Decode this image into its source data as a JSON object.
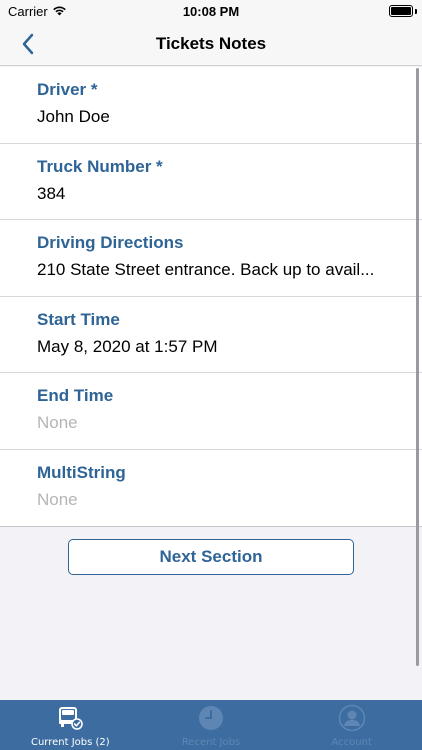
{
  "status_bar": {
    "carrier": "Carrier",
    "time": "10:08 PM"
  },
  "nav": {
    "title": "Tickets Notes"
  },
  "fields": [
    {
      "label": "Driver *",
      "value": "John Doe",
      "empty": false
    },
    {
      "label": "Truck Number *",
      "value": "384",
      "empty": false
    },
    {
      "label": "Driving Directions",
      "value": "210 State Street entrance. Back up to avail...",
      "empty": false
    },
    {
      "label": "Start Time",
      "value": "May 8, 2020 at 1:57 PM",
      "empty": false
    },
    {
      "label": "End Time",
      "value": "None",
      "empty": true
    },
    {
      "label": "MultiString",
      "value": "None",
      "empty": true
    }
  ],
  "next_button": {
    "label": "Next Section"
  },
  "tabs": [
    {
      "label": "Current Jobs (2)",
      "icon": "truck-icon",
      "active": true
    },
    {
      "label": "Recent Jobs",
      "icon": "clock-icon",
      "active": false
    },
    {
      "label": "Account",
      "icon": "person-icon",
      "active": false
    }
  ],
  "colors": {
    "accent": "#2f6496",
    "tab_bar": "#3d6da0",
    "placeholder": "#b5b5b8"
  }
}
